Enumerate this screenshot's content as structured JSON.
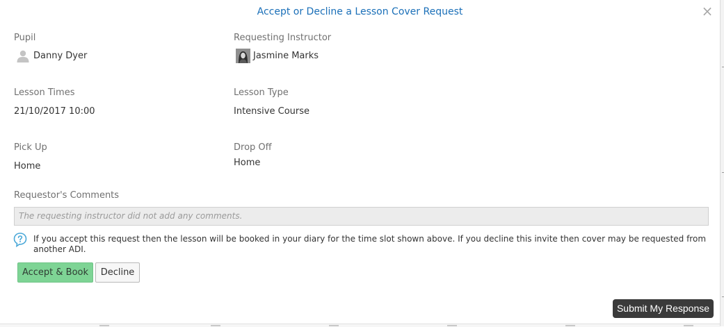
{
  "dialog": {
    "title": "Accept or Decline a Lesson Cover Request",
    "close_glyph": "×"
  },
  "pupil": {
    "label": "Pupil",
    "name": "Danny Dyer",
    "icon": "person-icon"
  },
  "requesting_instructor": {
    "label": "Requesting Instructor",
    "name": "Jasmine Marks",
    "icon": "avatar"
  },
  "lesson_times": {
    "label": "Lesson Times",
    "value": "21/10/2017 10:00"
  },
  "lesson_type": {
    "label": "Lesson Type",
    "value": "Intensive Course"
  },
  "pick_up": {
    "label": "Pick Up",
    "value": "Home"
  },
  "drop_off": {
    "label": "Drop Off",
    "value": "Home"
  },
  "comments": {
    "label": "Requestor's Comments",
    "value": "The requesting instructor did not add any comments."
  },
  "info": {
    "icon": "help-icon",
    "text": "If you accept this request then the lesson will be booked in your diary for the time slot shown above. If you decline this invite then cover may be requested from another ADI."
  },
  "actions": {
    "accept_label": "Accept & Book",
    "decline_label": "Decline",
    "submit_label": "Submit My Response"
  },
  "colors": {
    "title": "#1a6fb8",
    "accept_bg": "#7ed495",
    "submit_bg": "#3a3a3a",
    "help_icon": "#4aa8d8"
  }
}
